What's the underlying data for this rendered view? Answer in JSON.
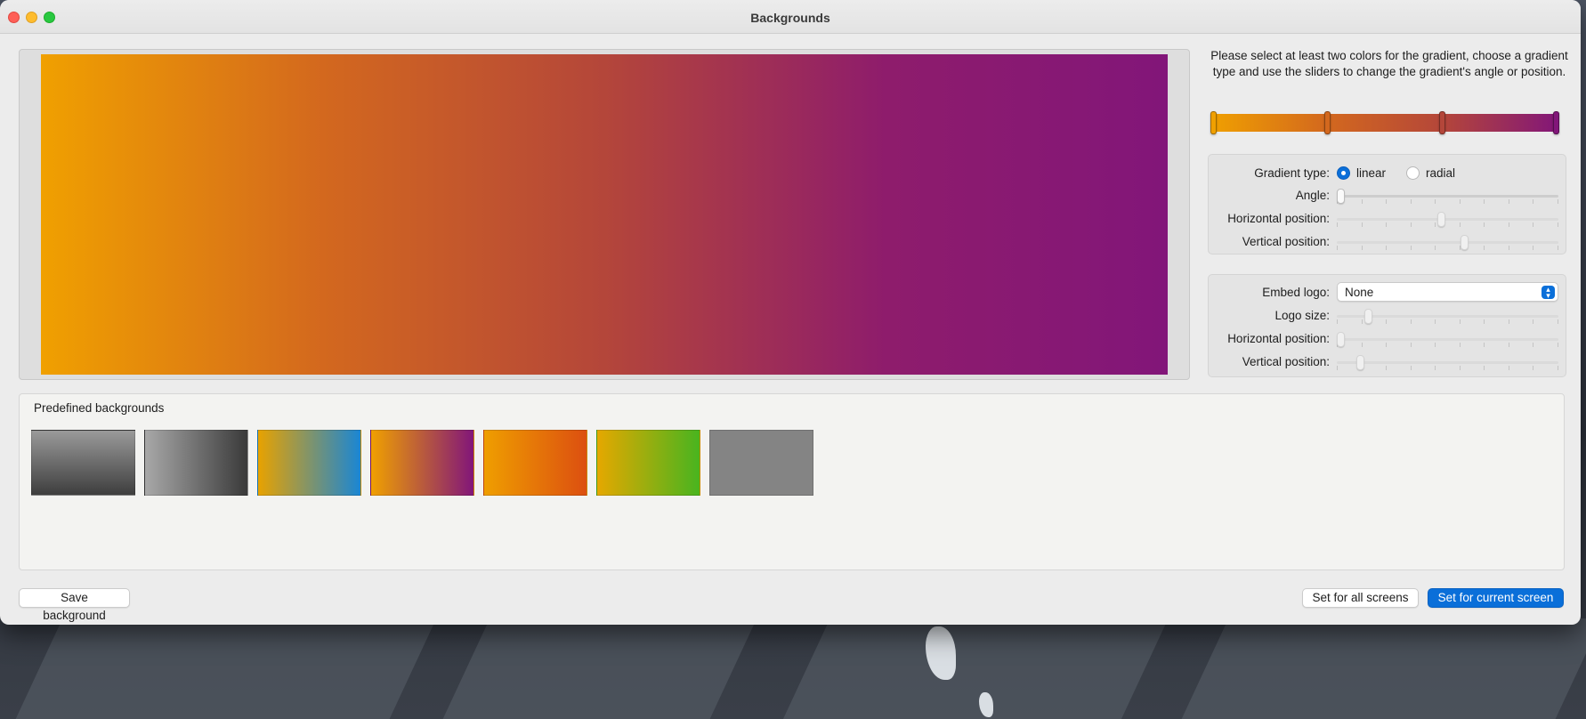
{
  "window": {
    "title": "Backgrounds"
  },
  "preview": {
    "gradient_colors": [
      "#f0a000",
      "#d3681e",
      "#b4463a",
      "#8e1c6c",
      "#821679"
    ]
  },
  "instructions": "Please select at least two colors for the gradient, choose a gradient type and use the sliders to change the gradient's angle or position.",
  "gradient_stops": [
    "#f0a000",
    "#d3681e",
    "#b4463a",
    "#821679"
  ],
  "gradient_settings": {
    "type_label": "Gradient type:",
    "option_linear": "linear",
    "option_radial": "radial",
    "selected_type": "linear",
    "angle_label": "Angle:",
    "angle_value": 0,
    "horizontal_label": "Horizontal position:",
    "horizontal_value": 0.47,
    "vertical_label": "Vertical position:",
    "vertical_value": 0.58
  },
  "logo_settings": {
    "embed_label": "Embed logo:",
    "embed_value": "None",
    "size_label": "Logo size:",
    "size_value": 0.13,
    "horizontal_label": "Horizontal position:",
    "horizontal_value": 0.0,
    "vertical_label": "Vertical position:",
    "vertical_value": 0.09
  },
  "predefined": {
    "title": "Predefined backgrounds",
    "items": [
      {
        "name": "gray-vertical",
        "colors": [
          "#9a9a9a",
          "#3e3e3e"
        ]
      },
      {
        "name": "gray-horizontal",
        "colors": [
          "#a8a8a8",
          "#3a3a3a"
        ]
      },
      {
        "name": "orange-blue",
        "colors": [
          "#e8a200",
          "#1a86d4"
        ]
      },
      {
        "name": "orange-purple",
        "colors": [
          "#f0a000",
          "#821679"
        ]
      },
      {
        "name": "orange-red",
        "colors": [
          "#ef9e00",
          "#dc4f10"
        ]
      },
      {
        "name": "yellow-green",
        "colors": [
          "#e5a800",
          "#49b41f"
        ]
      },
      {
        "name": "solid-gray",
        "colors": [
          "#848484",
          "#848484"
        ]
      }
    ]
  },
  "buttons": {
    "save": "Save background",
    "all_screens": "Set for all screens",
    "current_screen": "Set for current screen"
  }
}
